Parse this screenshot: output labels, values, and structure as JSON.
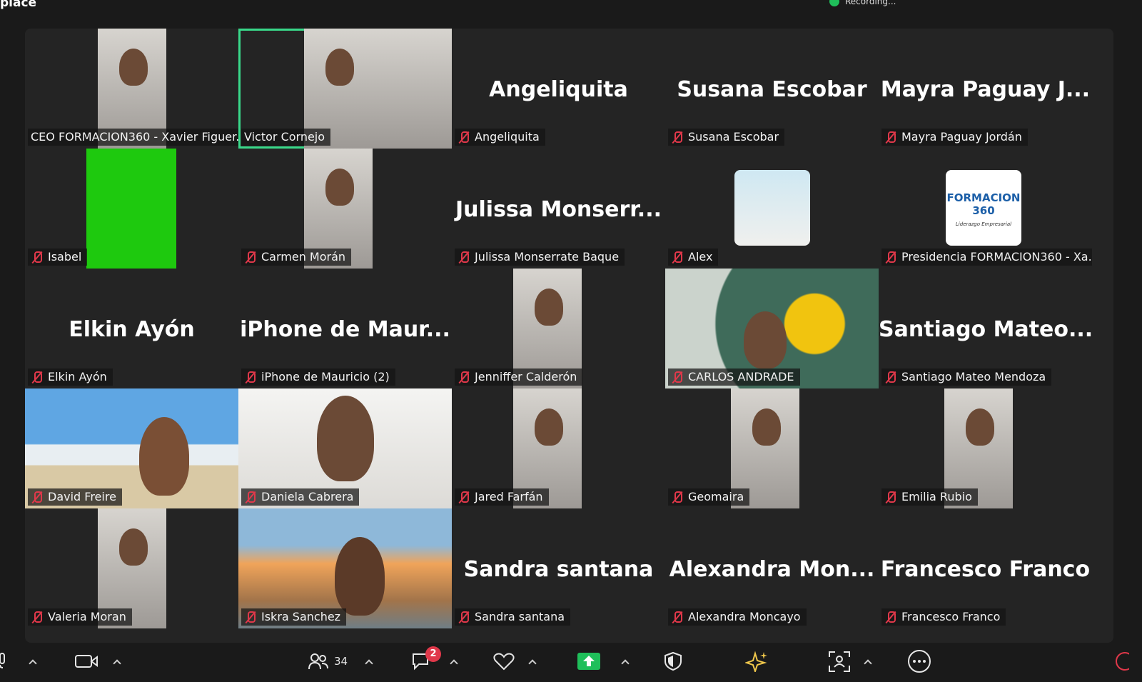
{
  "window": {
    "title": "place",
    "recording_label": "Recording..."
  },
  "tiles": [
    {
      "id": "t1",
      "label": "CEO FORMACION360 - Xavier Figuer...",
      "big": "",
      "muted": false,
      "video": "cam"
    },
    {
      "id": "t2",
      "label": "Victor Cornejo",
      "big": "",
      "muted": false,
      "video": "cam",
      "active": true
    },
    {
      "id": "t3",
      "label": "Angeliquita",
      "big": "Angeliquita",
      "muted": true
    },
    {
      "id": "t4",
      "label": "Susana Escobar",
      "big": "Susana Escobar",
      "muted": true
    },
    {
      "id": "t5",
      "label": "Mayra Paguay Jordán",
      "big": "Mayra  Paguay  J...",
      "muted": true
    },
    {
      "id": "t6",
      "label": "Isabel",
      "big": "",
      "muted": true,
      "video": "green"
    },
    {
      "id": "t7",
      "label": "Carmen Morán",
      "big": "",
      "muted": true,
      "video": "cam"
    },
    {
      "id": "t8",
      "label": "Julissa Monserrate Baque",
      "big": "Julissa  Monserr...",
      "muted": true
    },
    {
      "id": "t9",
      "label": "Alex",
      "big": "",
      "muted": true,
      "video": "avatar"
    },
    {
      "id": "t10",
      "label": "Presidencia FORMACION360 - Xa...",
      "big": "",
      "muted": true,
      "video": "logo"
    },
    {
      "id": "t11",
      "label": "Elkin Ayón",
      "big": "Elkin Ayón",
      "muted": true
    },
    {
      "id": "t12",
      "label": "iPhone de Mauricio (2)",
      "big": "iPhone  de  Maur...",
      "muted": true
    },
    {
      "id": "t13",
      "label": "Jenniffer Calderón",
      "big": "",
      "muted": true,
      "video": "cam"
    },
    {
      "id": "t14",
      "label": "CARLOS ANDRADE",
      "big": "",
      "muted": true,
      "video": "flowers"
    },
    {
      "id": "t15",
      "label": "Santiago Mateo Mendoza",
      "big": "Santiago  Mateo...",
      "muted": true
    },
    {
      "id": "t16",
      "label": "David Freire",
      "big": "",
      "muted": true,
      "video": "beach"
    },
    {
      "id": "t17",
      "label": "Daniela Cabrera",
      "big": "",
      "muted": true,
      "video": "wide"
    },
    {
      "id": "t18",
      "label": "Jared Farfán",
      "big": "",
      "muted": true,
      "video": "cam"
    },
    {
      "id": "t19",
      "label": "Geomaira",
      "big": "",
      "muted": true,
      "video": "cam"
    },
    {
      "id": "t20",
      "label": "Emilia Rubio",
      "big": "",
      "muted": true,
      "video": "cam"
    },
    {
      "id": "t21",
      "label": "Valeria Moran",
      "big": "",
      "muted": true,
      "video": "cam"
    },
    {
      "id": "t22",
      "label": "Iskra Sanchez",
      "big": "",
      "muted": true,
      "video": "bridge"
    },
    {
      "id": "t23",
      "label": "Sandra santana",
      "big": "Sandra santana",
      "muted": true
    },
    {
      "id": "t24",
      "label": "Alexandra Moncayo",
      "big": "Alexandra  Mon...",
      "muted": true
    },
    {
      "id": "t25",
      "label": "Francesco Franco",
      "big": "Francesco Franco",
      "muted": true
    }
  ],
  "logo_text": {
    "line1": "FORMACION",
    "line2": "360",
    "tagline": "Liderazgo Empresarial"
  },
  "toolbar": {
    "participants_count": "34",
    "chat_badge": "2"
  },
  "colors": {
    "accent_green": "#39d98a",
    "mute_red": "#e0384a",
    "share_green": "#1fbf5a"
  }
}
